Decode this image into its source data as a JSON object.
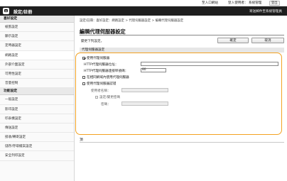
{
  "topbar": {
    "portal": "至入口網站",
    "login_user": "登入使用者：",
    "user": "系統管理",
    "logout": "登出",
    "mail_link": "寄送郵件至系統管理員"
  },
  "header": {
    "title": "設定/註冊",
    "link": "寄送郵件至系統管理員"
  },
  "sidebar": {
    "section1": "喜好設定",
    "section1_items": [
      "紙張設定",
      "顯示設定",
      "定時器設定",
      "網路設定",
      "外部介面設定",
      "可用性設定",
      "音量控制"
    ],
    "section2": "功能設定",
    "section2_items": [
      "一般設定",
      "影印設定",
      "印表機設定",
      "傳送設定",
      "接收/轉寄設定",
      "儲存/存取檔案設定",
      "安全列印設定"
    ]
  },
  "main": {
    "breadcrumb": "設定/註冊：喜好設定：網路設定 > 代理伺服器設定 > 編輯代理伺服器設定",
    "title": "編輯代理伺服器設定",
    "prompt": "變更下列設定。",
    "ok_label": "確定",
    "cancel_label": "取消",
    "section_header": "代理伺服器設定",
    "use_proxy_label": "使用代理伺服器",
    "use_proxy_checked": true,
    "http_address_label": "HTTP代理伺服器位址：",
    "http_address_value": "",
    "http_port_label": "HTTP代理伺服器連接埠號碼：",
    "http_port_value": "80",
    "same_domain_label": "在相同網域內使用代理伺服器",
    "same_domain_checked": false,
    "use_auth_label": "使用代理伺服器認證",
    "use_auth_checked": false,
    "username_label": "使用者名稱：",
    "username_value": "",
    "set_password_label": "設定/變更密碼",
    "set_password_checked": false,
    "password_label": "密碼：",
    "password_value": "",
    "top_link": "頂"
  }
}
